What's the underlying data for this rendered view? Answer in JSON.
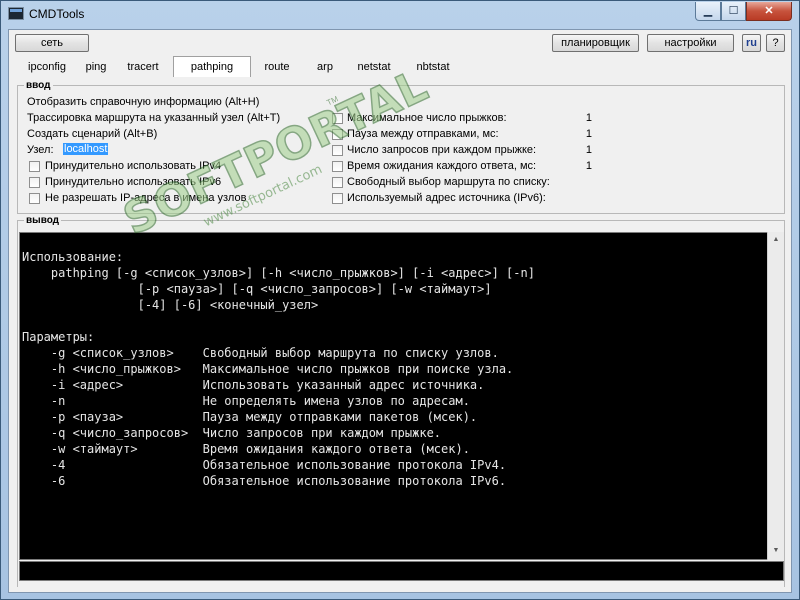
{
  "window": {
    "title": "CMDTools"
  },
  "window_controls": {
    "minimize": "▁",
    "maximize": "☐",
    "close": "✕"
  },
  "toolbar": {
    "network_btn": "сеть",
    "scheduler_btn": "планировщик",
    "settings_btn": "настройки",
    "lang_btn": "ru",
    "help_btn": "?"
  },
  "tabs": [
    "ipconfig",
    "ping",
    "tracert",
    "pathping",
    "route",
    "arp",
    "netstat",
    "nbtstat"
  ],
  "active_tab": "pathping",
  "input": {
    "legend": "ввод",
    "help_line": "Отобразить справочную информацию (Alt+H)",
    "trace_line": "Трассировка маршрута на указанный узел (Alt+T)",
    "script_line": "Создать сценарий (Alt+B)",
    "host_label": "Узел:",
    "host_value": "localhost",
    "left_options": [
      "Принудительно использовать IPv4",
      "Принудительно использовать IPv6",
      "Не разрешать IP-адреса в имена узлов"
    ],
    "right_options": [
      {
        "label": "Максимальное число прыжков:",
        "value": "1"
      },
      {
        "label": "Пауза между отправками, мс:",
        "value": "1"
      },
      {
        "label": "Число запросов при каждом прыжке:",
        "value": "1"
      },
      {
        "label": "Время ожидания каждого ответа, мс:",
        "value": "1"
      },
      {
        "label": "Свободный выбор маршрута по списку:",
        "value": ""
      },
      {
        "label": "Используемый адрес источника (IPv6):",
        "value": ""
      }
    ]
  },
  "output": {
    "legend": "вывод",
    "text": "Использование:\n    pathping [-g <список_узлов>] [-h <число_прыжков>] [-i <адрес>] [-n]\n                [-p <пауза>] [-q <число_запросов>] [-w <таймаут>]\n                [-4] [-6] <конечный_узел>\n\nПараметры:\n    -g <список_узлов>    Свободный выбор маршрута по списку узлов.\n    -h <число_прыжков>   Максимальное число прыжков при поиске узла.\n    -i <адрес>           Использовать указанный адрес источника.\n    -n                   Не определять имена узлов по адресам.\n    -p <пауза>           Пауза между отправками пакетов (мсек).\n    -q <число_запросов>  Число запросов при каждом прыжке.\n    -w <таймаут>         Время ожидания каждого ответа (мсек).\n    -4                   Обязательное использование протокола IPv4.\n    -6                   Обязательное использование протокола IPv6."
  },
  "watermark": {
    "main": "SOFTPORTAL",
    "sub": "www.softportal.com",
    "tm": "TM"
  },
  "colors": {
    "accent": "#3399ff",
    "console_bg": "#000000",
    "console_fg": "#e6e6e6",
    "watermark": "#9fcf8b"
  }
}
